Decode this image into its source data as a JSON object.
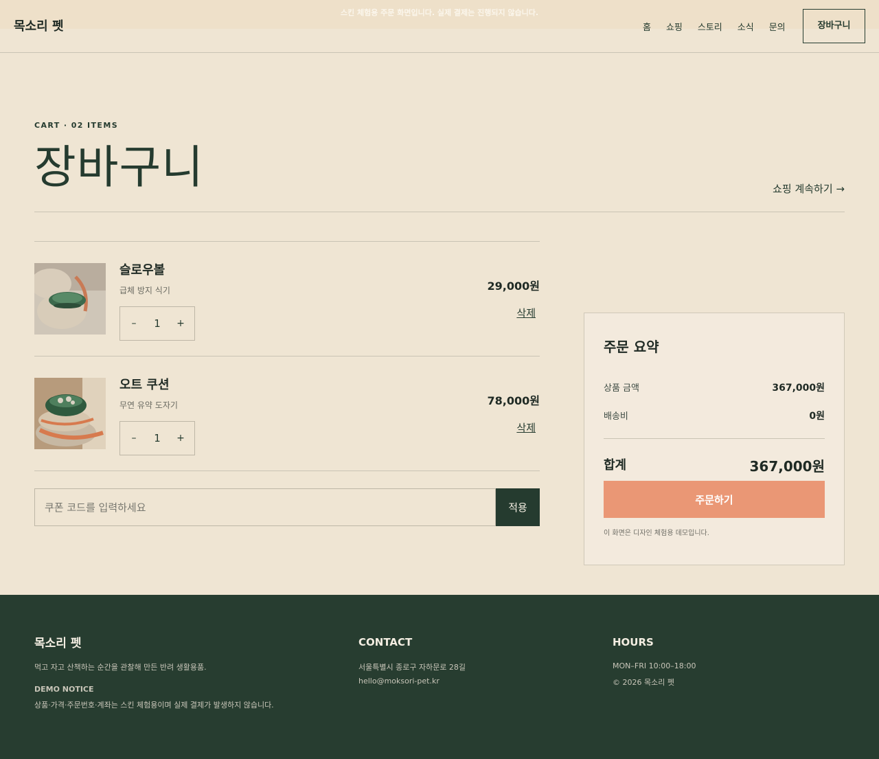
{
  "notice": "스킨 체험용 주문 화면입니다. 실제 결제는 진행되지 않습니다.",
  "header": {
    "logo": "목소리 펫",
    "nav": [
      "홈",
      "쇼핑",
      "스토리",
      "소식",
      "문의"
    ],
    "cart_label": "장바구니"
  },
  "page": {
    "eyebrow": "CART · 02 ITEMS",
    "title": "장바구니",
    "continue_shopping": "쇼핑 계속하기 →"
  },
  "cart": {
    "items": [
      {
        "name": "슬로우볼",
        "desc": "급체 방지 식기",
        "qty": "1",
        "price": "29,000원",
        "remove": "삭제",
        "dec": "–",
        "inc": "+"
      },
      {
        "name": "오트 쿠션",
        "desc": "무연 유약 도자기",
        "qty": "1",
        "price": "78,000원",
        "remove": "삭제",
        "dec": "–",
        "inc": "+"
      }
    ],
    "coupon_placeholder": "쿠폰 코드를 입력하세요",
    "coupon_apply": "적용"
  },
  "summary": {
    "title": "주문 요약",
    "subtotal_label": "상품 금액",
    "subtotal_value": "367,000원",
    "shipping_label": "배송비",
    "shipping_value": "0원",
    "total_label": "합계",
    "total_value": "367,000원",
    "checkout_label": "주문하기",
    "note": "이 화면은 디자인 체험용 데모입니다."
  },
  "footer": {
    "logo": "목소리 펫",
    "tagline": "먹고 자고 산책하는 순간을 관찰해 만든 반려 생활용품.",
    "demo_label": "DEMO NOTICE",
    "demo_text": "상품·가격·주문번호·계좌는 스킨 체험용이며 실제 결제가 발생하지 않습니다.",
    "contact_head": "CONTACT",
    "address": "서울특별시 종로구 자하문로 28길",
    "email": "hello@moksori-pet.kr",
    "hours_head": "HOURS",
    "hours": "MON–FRI 10:00–18:00",
    "copyright": "© 2026 목소리 펫"
  },
  "colors": {
    "background": "#efe5d3",
    "primary": "#253b2f",
    "accent": "#ea9775",
    "summary_bg": "#f3eadd"
  }
}
